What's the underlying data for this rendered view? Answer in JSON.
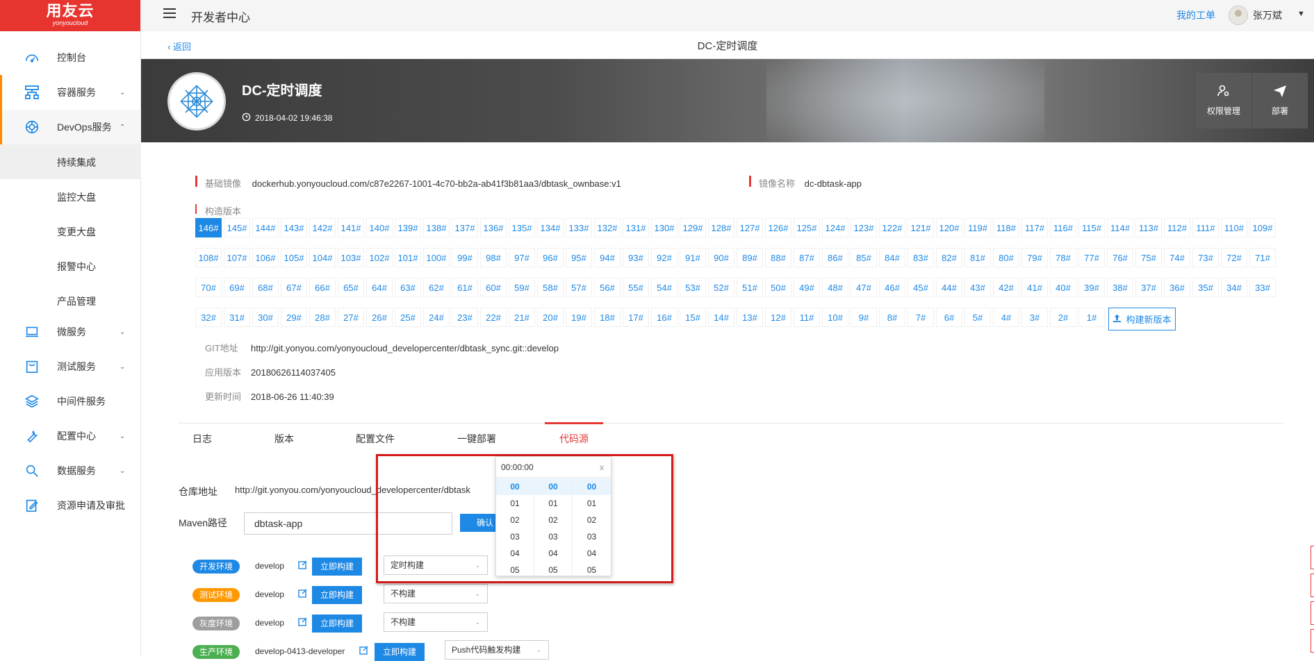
{
  "logo": {
    "main": "用友云",
    "sub": "yonyoucloud"
  },
  "sidebar": {
    "items": [
      {
        "label": "控制台",
        "icon": "dashboard-icon"
      },
      {
        "label": "容器服务",
        "icon": "container-icon"
      },
      {
        "label": "DevOps服务",
        "icon": "devops-icon"
      },
      {
        "label": "微服务",
        "icon": "laptop-icon"
      },
      {
        "label": "测试服务",
        "icon": "test-bag-icon"
      },
      {
        "label": "中间件服务",
        "icon": "layers-icon"
      },
      {
        "label": "配置中心",
        "icon": "wrench-icon"
      },
      {
        "label": "数据服务",
        "icon": "search-data-icon"
      },
      {
        "label": "资源申请及审批",
        "icon": "edit-doc-icon"
      }
    ],
    "devops_sub": [
      "持续集成",
      "监控大盘",
      "变更大盘",
      "报警中心",
      "产品管理"
    ]
  },
  "topbar": {
    "title": "开发者中心",
    "my_ticket": "我的工单",
    "username": "张万斌"
  },
  "subheader": {
    "back": "返回",
    "title": "DC-定时调度"
  },
  "banner": {
    "app_name": "DC-定时调度",
    "created_time": "2018-04-02 19:46:38",
    "buttons": [
      {
        "label": "权限管理",
        "icon": "user-settings-icon"
      },
      {
        "label": "部署",
        "icon": "send-icon"
      }
    ]
  },
  "info": {
    "base_image_label": "基础镜像",
    "base_image": "dockerhub.yonyoucloud.com/c87e2267-1001-4c70-bb2a-ab41f3b81aa3/dbtask_ownbase:v1",
    "image_name_label": "镜像名称",
    "image_name": "dc-dbtask-app",
    "build_version_label": "构造版本"
  },
  "versions": [
    "146#",
    "145#",
    "144#",
    "143#",
    "142#",
    "141#",
    "140#",
    "139#",
    "138#",
    "137#",
    "136#",
    "135#",
    "134#",
    "133#",
    "132#",
    "131#",
    "130#",
    "129#",
    "128#",
    "127#",
    "126#",
    "125#",
    "124#",
    "123#",
    "122#",
    "121#",
    "120#",
    "119#",
    "118#",
    "117#",
    "116#",
    "115#",
    "114#",
    "113#",
    "112#",
    "111#",
    "110#",
    "109#",
    "108#",
    "107#",
    "106#",
    "105#",
    "104#",
    "103#",
    "102#",
    "101#",
    "100#",
    "99#",
    "98#",
    "97#",
    "96#",
    "95#",
    "94#",
    "93#",
    "92#",
    "91#",
    "90#",
    "89#",
    "88#",
    "87#",
    "86#",
    "85#",
    "84#",
    "83#",
    "82#",
    "81#",
    "80#",
    "79#",
    "78#",
    "77#",
    "76#",
    "75#",
    "74#",
    "73#",
    "72#",
    "71#",
    "70#",
    "69#",
    "68#",
    "67#",
    "66#",
    "65#",
    "64#",
    "63#",
    "62#",
    "61#",
    "60#",
    "59#",
    "58#",
    "57#",
    "56#",
    "55#",
    "54#",
    "53#",
    "52#",
    "51#",
    "50#",
    "49#",
    "48#",
    "47#",
    "46#",
    "45#",
    "44#",
    "43#",
    "42#",
    "41#",
    "40#",
    "39#",
    "38#",
    "37#",
    "36#",
    "35#",
    "34#",
    "33#",
    "32#",
    "31#",
    "30#",
    "29#",
    "28#",
    "27#",
    "26#",
    "25#",
    "24#",
    "23#",
    "22#",
    "21#",
    "20#",
    "19#",
    "18#",
    "17#",
    "16#",
    "15#",
    "14#",
    "13#",
    "12#",
    "11#",
    "10#",
    "9#",
    "8#",
    "7#",
    "6#",
    "5#",
    "4#",
    "3#",
    "2#",
    "1#"
  ],
  "selected_version": "146#",
  "new_version_label": "构建新版本",
  "meta": {
    "git_label": "GIT地址",
    "git": "http://git.yonyou.com/yonyoucloud_developercenter/dbtask_sync.git::develop",
    "app_ver_label": "应用版本",
    "app_ver": "20180626114037405",
    "updated_label": "更新时间",
    "updated": "2018-06-26 11:40:39"
  },
  "tabs": [
    "日志",
    "版本",
    "配置文件",
    "一键部署",
    "代码源"
  ],
  "active_tab": "代码源",
  "form": {
    "repo_label": "仓库地址",
    "repo": "http://git.yonyou.com/yonyoucloud_developercenter/dbtask",
    "maven_label": "Maven路径",
    "maven_value": "dbtask-app",
    "confirm": "确认"
  },
  "envs": [
    {
      "name": "开发环境",
      "color": "#1e88e5",
      "branch": "develop",
      "build": "立即构建",
      "mode": "定时构建"
    },
    {
      "name": "测试环境",
      "color": "#ff9800",
      "branch": "develop",
      "build": "立即构建",
      "mode": "不构建"
    },
    {
      "name": "灰度环境",
      "color": "#9e9e9e",
      "branch": "develop",
      "build": "立即构建",
      "mode": "不构建"
    },
    {
      "name": "生产环境",
      "color": "#4caf50",
      "branch": "develop-0413-developer",
      "build": "立即构建",
      "mode": "Push代码触发构建"
    }
  ],
  "time_picker": {
    "value": "00:00:00",
    "close": "x",
    "hours": [
      "00",
      "01",
      "02",
      "03",
      "04",
      "05"
    ],
    "minutes": [
      "00",
      "01",
      "02",
      "03",
      "04",
      "05"
    ],
    "seconds": [
      "00",
      "01",
      "02",
      "03",
      "04",
      "05"
    ]
  }
}
